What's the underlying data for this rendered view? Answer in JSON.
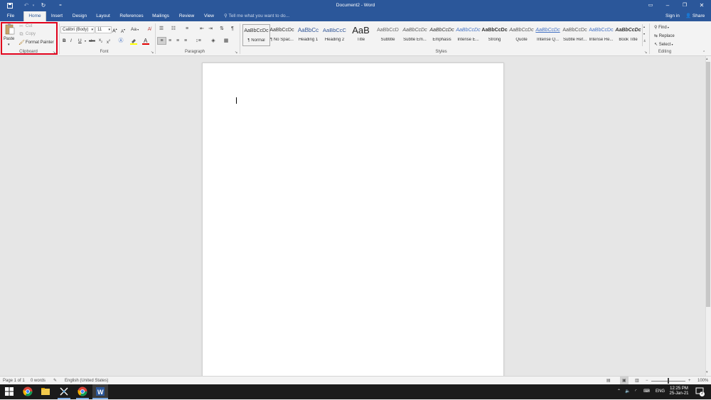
{
  "window": {
    "title": "Document2 - Word",
    "quick_access": {
      "save": "save-icon",
      "undo": "undo-icon",
      "redo": "redo-icon",
      "customize": "="
    },
    "sign_in": "Sign in",
    "share": "Share"
  },
  "tabs": [
    "File",
    "Home",
    "Insert",
    "Design",
    "Layout",
    "References",
    "Mailings",
    "Review",
    "View"
  ],
  "active_tab": "Home",
  "tell_me": "Tell me what you want to do...",
  "ribbon": {
    "clipboard": {
      "label": "Clipboard",
      "paste": "Paste",
      "cut": "Cut",
      "copy": "Copy",
      "format_painter": "Format Painter"
    },
    "font": {
      "label": "Font",
      "name": "Calibri (Body)",
      "size": "11",
      "grow": "A",
      "shrink": "A",
      "change_case": "Aa",
      "bold": "B",
      "italic": "I",
      "underline": "U",
      "strike": "abc",
      "subscript": "x",
      "superscript": "x"
    },
    "paragraph": {
      "label": "Paragraph",
      "show_marks": "¶"
    },
    "styles": {
      "label": "Styles",
      "items": [
        {
          "preview": "AaBbCcDc",
          "name": "¶ Normal"
        },
        {
          "preview": "AaBbCcDc",
          "name": "¶ No Spac..."
        },
        {
          "preview": "AaBbCc",
          "name": "Heading 1"
        },
        {
          "preview": "AaBbCcC",
          "name": "Heading 2"
        },
        {
          "preview": "AaB",
          "name": "Title"
        },
        {
          "preview": "AaBbCcD",
          "name": "Subtitle"
        },
        {
          "preview": "AaBbCcDc",
          "name": "Subtle Em..."
        },
        {
          "preview": "AaBbCcDc",
          "name": "Emphasis"
        },
        {
          "preview": "AaBbCcDc",
          "name": "Intense E..."
        },
        {
          "preview": "AaBbCcDc",
          "name": "Strong"
        },
        {
          "preview": "AaBbCcDc",
          "name": "Quote"
        },
        {
          "preview": "AaBbCcDc",
          "name": "Intense Q..."
        },
        {
          "preview": "AaBbCcDc",
          "name": "Subtle Ref..."
        },
        {
          "preview": "AaBbCcDc",
          "name": "Intense Re..."
        },
        {
          "preview": "AaBbCcDc",
          "name": "Book Title"
        }
      ]
    },
    "editing": {
      "label": "Editing",
      "find": "Find",
      "replace": "Replace",
      "select": "Select"
    }
  },
  "status": {
    "page": "Page 1 of 1",
    "words": "0 words",
    "language": "English (United States)",
    "zoom": "100%"
  },
  "taskbar": {
    "language": "ENG",
    "time": "12:25 PM",
    "date": "25-Jan-21",
    "notification_count": "2"
  }
}
